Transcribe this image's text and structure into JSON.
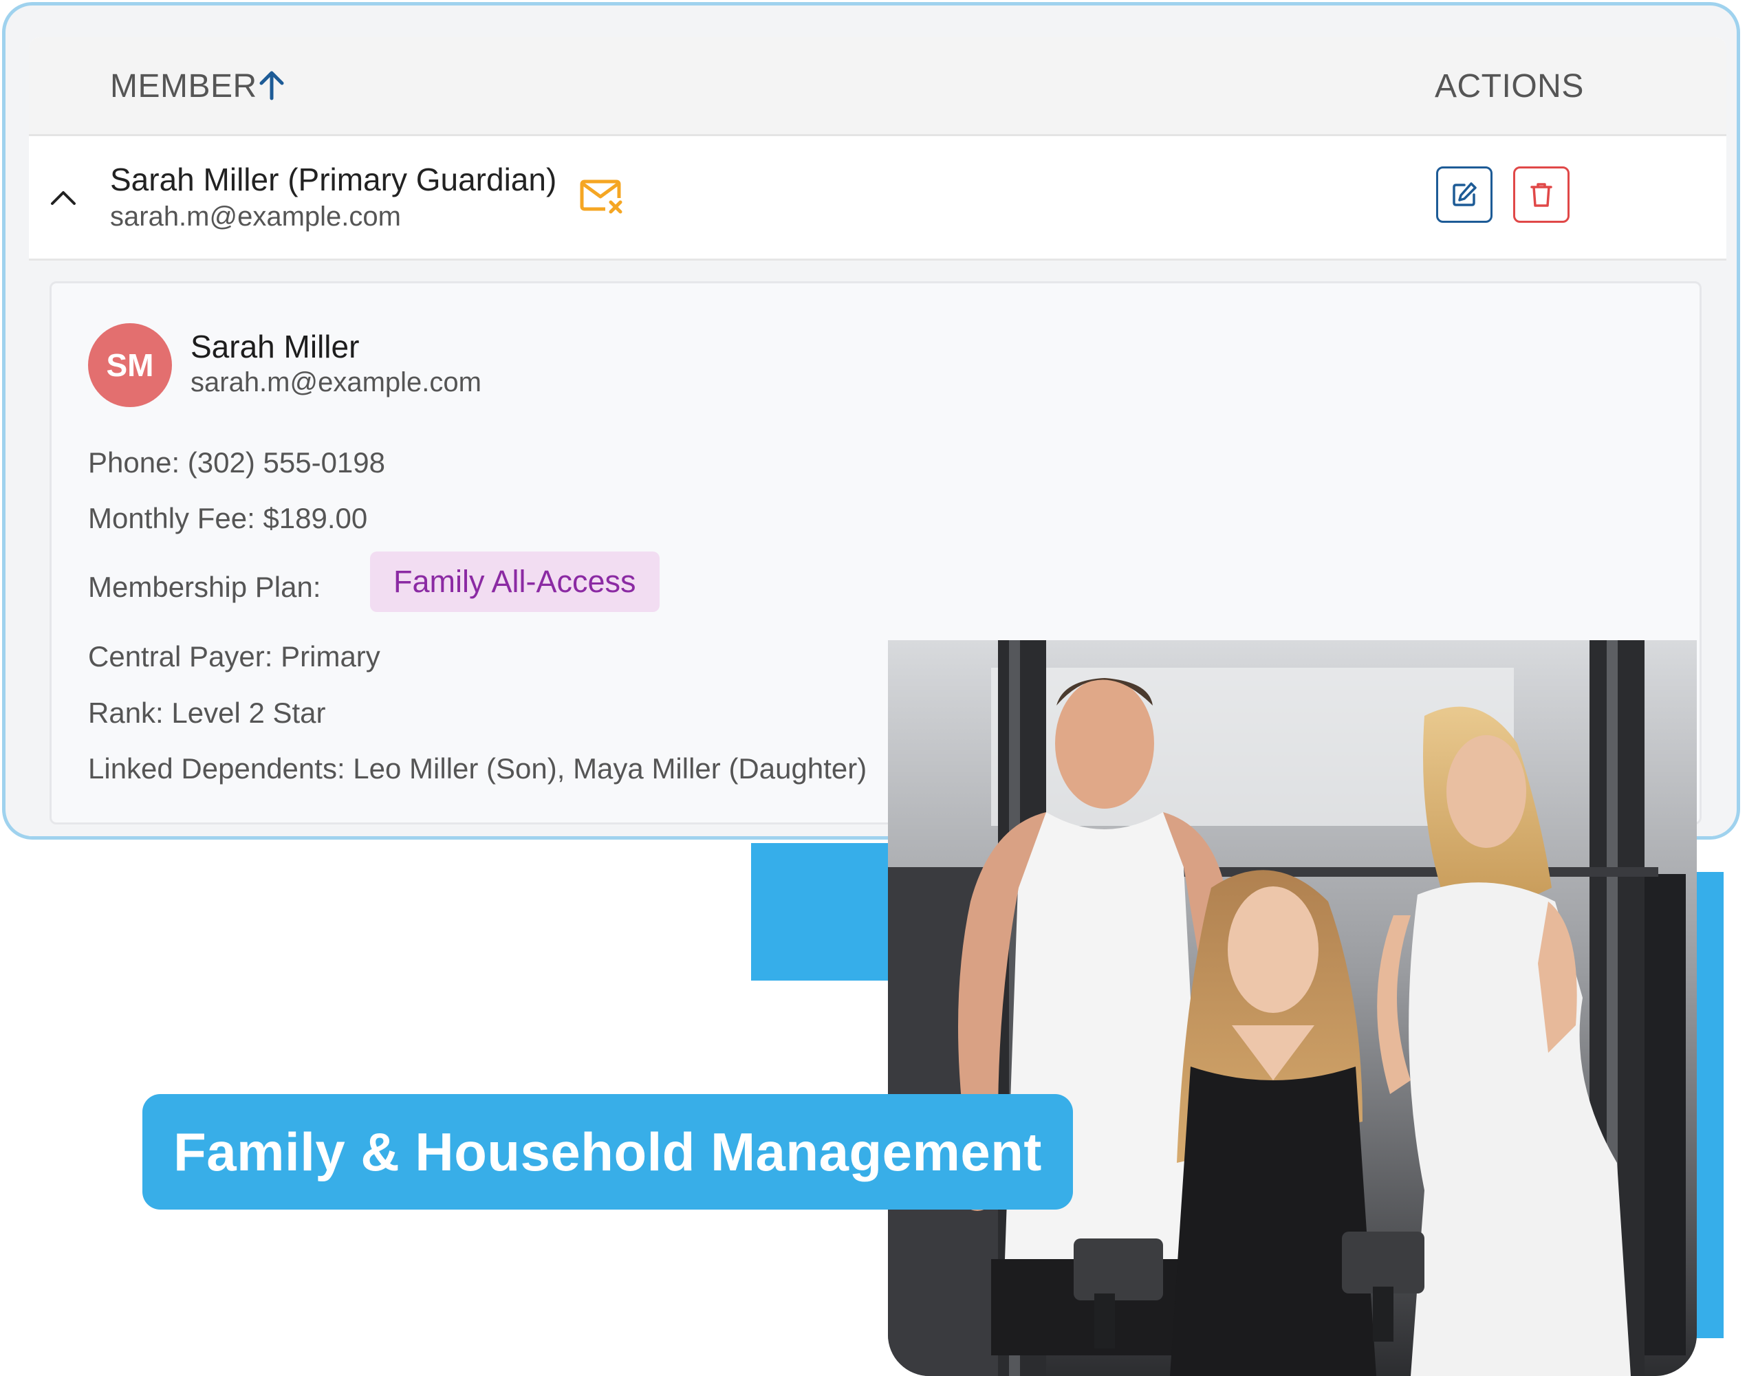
{
  "table": {
    "header": {
      "member_label": "MEMBER",
      "actions_label": "ACTIONS",
      "sort_icon": "arrow-up-icon"
    },
    "row": {
      "name": "Sarah Miller (Primary Guardian)",
      "email": "sarah.m@example.com",
      "status_icon": "mail-x-icon",
      "expand_icon": "chevron-up-icon",
      "actions": [
        "edit-icon",
        "trash-icon"
      ]
    },
    "detail": {
      "avatar_initials": "SM",
      "name": "Sarah Miller",
      "email": "sarah.m@example.com",
      "phone_label": "Phone:",
      "phone": "(302) 555-0198",
      "fee_label": "Monthly Fee:",
      "fee": "$189.00",
      "plan_label": "Membership Plan:",
      "plan": "Family All-Access",
      "payer_label": "Central Payer:",
      "payer": "Primary",
      "rank_label": "Rank:",
      "rank": "Level 2 Star",
      "dependents_label": "Linked Dependents:",
      "dependents": "Leo Miller (Son), Maya Miller (Daughter)"
    }
  },
  "banner": {
    "text": "Family & Household Management"
  },
  "colors": {
    "accent_blue": "#36aeea",
    "card_border": "#9fd2ee",
    "edit_button": "#1d5b96",
    "delete_button": "#e04848",
    "mail_icon": "#f5a623",
    "avatar_bg": "#e36f6f",
    "plan_badge_bg": "#f2ddf2",
    "plan_badge_text": "#8b2aa3"
  }
}
